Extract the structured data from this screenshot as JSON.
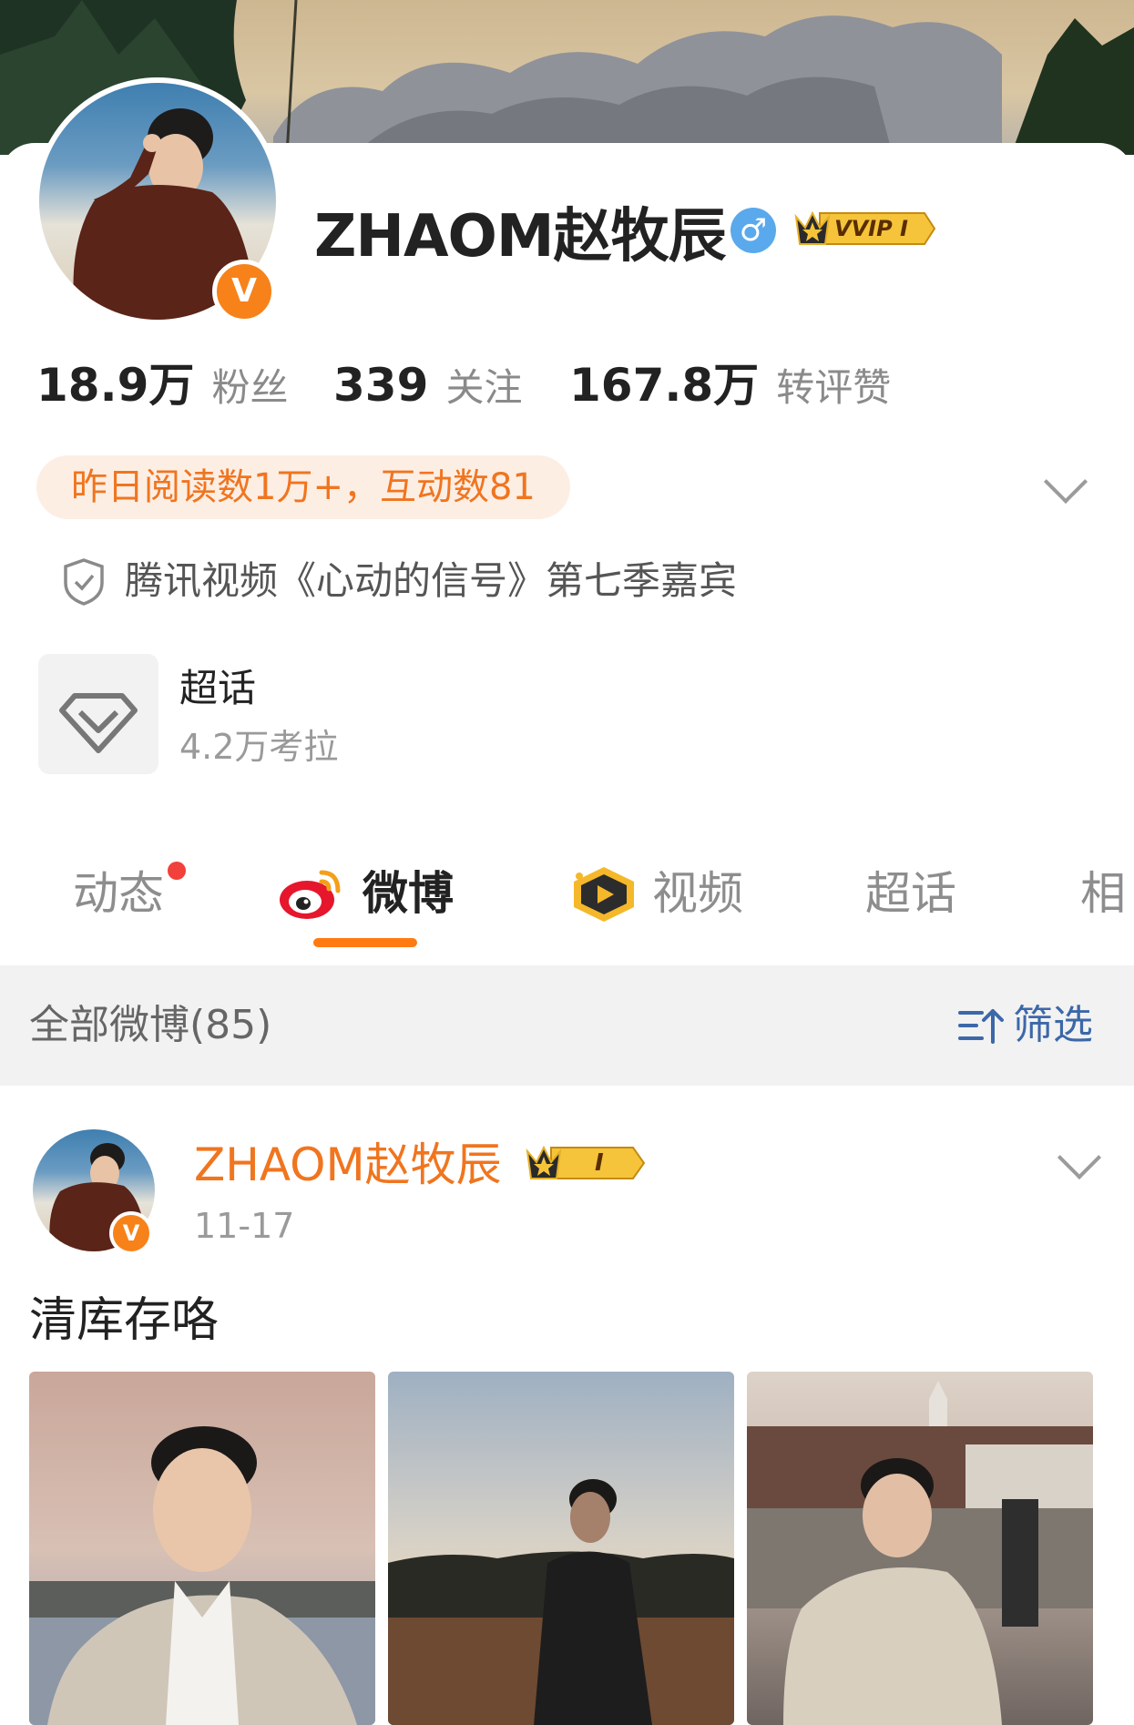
{
  "profile": {
    "name": "ZHAOM赵牧辰",
    "gender_symbol": "♂",
    "vip_badge": "VVIP I",
    "verified_mark": "V"
  },
  "stats": [
    {
      "value": "18.9万",
      "label": "粉丝"
    },
    {
      "value": "339",
      "label": "关注"
    },
    {
      "value": "167.8万",
      "label": "转评赞"
    }
  ],
  "reading_summary": "昨日阅读数1万+，互动数81",
  "certification": "腾讯视频《心动的信号》第七季嘉宾",
  "super_topic": {
    "title": "超话",
    "subtitle": "4.2万考拉"
  },
  "tabs": [
    {
      "label": "动态",
      "active": false
    },
    {
      "label": "微博",
      "active": true
    },
    {
      "label": "视频",
      "active": false
    },
    {
      "label": "超话",
      "active": false
    },
    {
      "label": "相",
      "active": false
    }
  ],
  "filter_bar": {
    "all_count_label": "全部微博(85)",
    "filter_label": "筛选"
  },
  "post": {
    "author": "ZHAOM赵牧辰",
    "vip_level": "I",
    "date": "11-17",
    "text": "清库存咯"
  },
  "colors": {
    "accent_orange": "#f0751f",
    "tab_underline": "#ff7a10",
    "link_blue": "#3c68a8",
    "verified_badge": "#f7821a",
    "gender_blue": "#5aa9ec"
  },
  "icons": [
    "verified-v-icon",
    "male-gender-icon",
    "vvip-crown-icon",
    "chevron-down-icon",
    "shield-check-icon",
    "diamond-icon",
    "weibo-logo-icon",
    "video-play-icon",
    "filter-sort-icon",
    "red-dot-icon"
  ]
}
